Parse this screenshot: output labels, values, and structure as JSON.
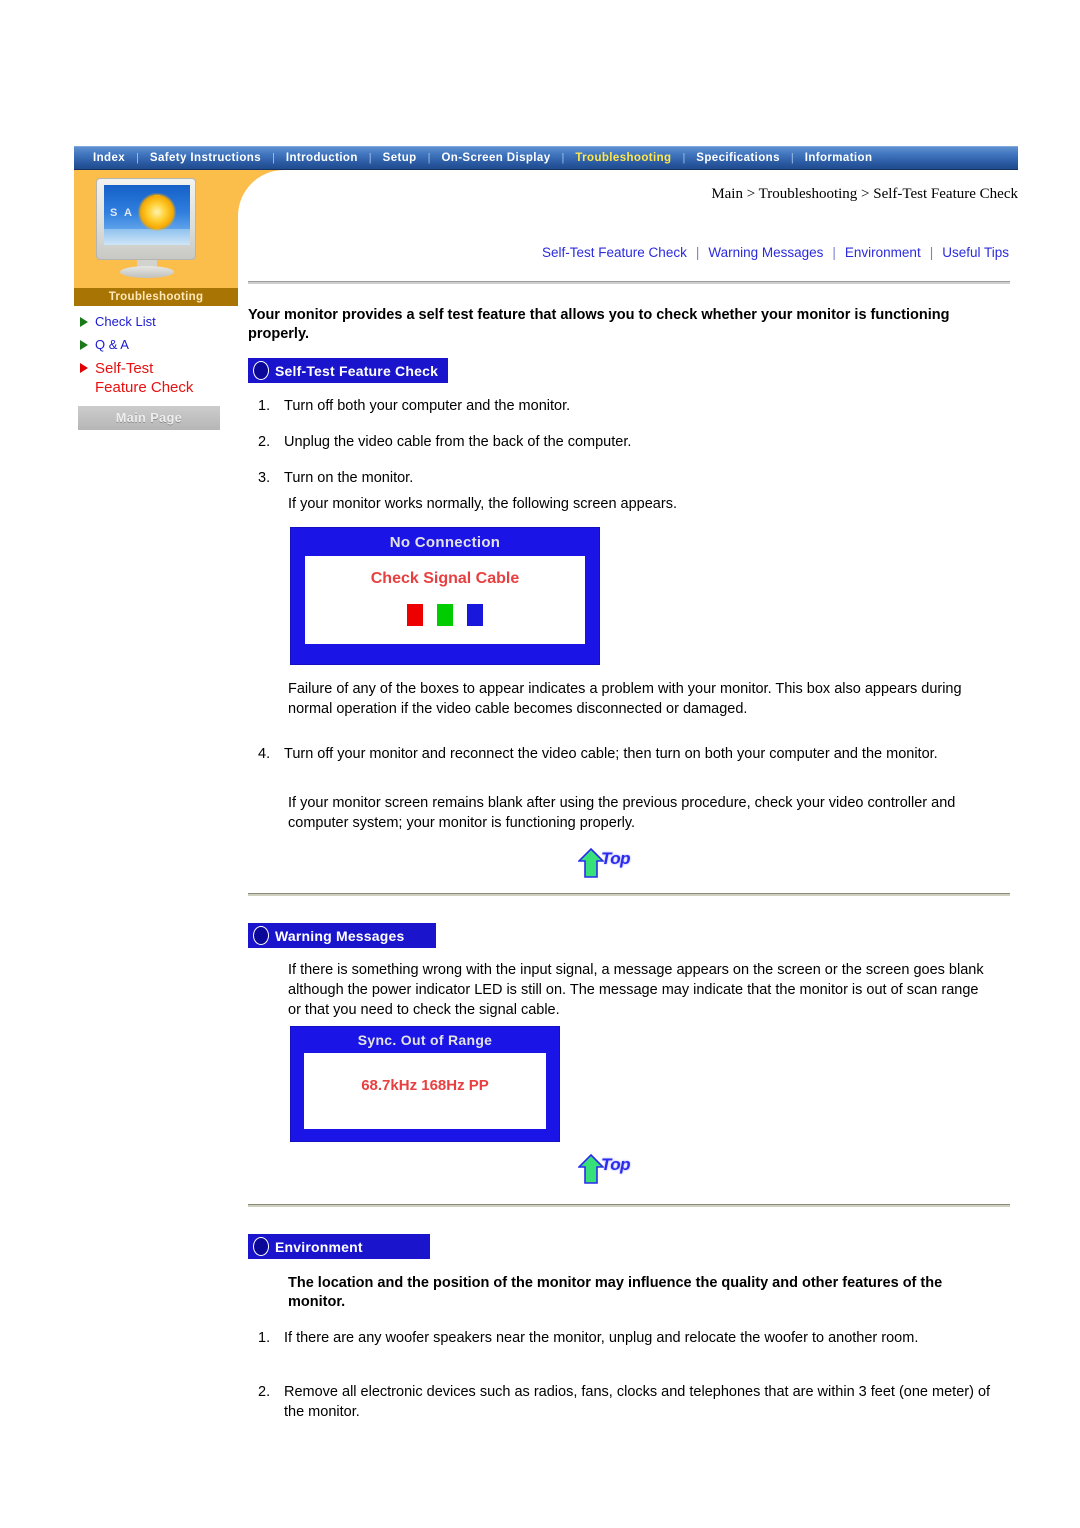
{
  "topnav": {
    "items": [
      {
        "label": "Index",
        "active": false
      },
      {
        "label": "Safety Instructions",
        "active": false
      },
      {
        "label": "Introduction",
        "active": false
      },
      {
        "label": "Setup",
        "active": false
      },
      {
        "label": "On-Screen Display",
        "active": false
      },
      {
        "label": "Troubleshooting",
        "active": true
      },
      {
        "label": "Specifications",
        "active": false
      },
      {
        "label": "Information",
        "active": false
      }
    ],
    "separator": "|",
    "active_color": "#ffe74c"
  },
  "sidebar": {
    "thumbnail_caption": "Troubleshooting",
    "thumbnail_screen_text": "S A",
    "links": [
      {
        "label": "Check List",
        "selected": false
      },
      {
        "label": "Q & A",
        "selected": false
      },
      {
        "label": "Self-Test",
        "label2": "Feature Check",
        "selected": true
      }
    ],
    "main_page_button": "Main Page",
    "panel_color": "#fbbe4b",
    "caption_bar_color": "#a87505",
    "link_color": "#1a1ad0",
    "selected_link_color": "#e81010"
  },
  "breadcrumb": "Main > Troubleshooting > Self-Test Feature Check",
  "sublinks": {
    "items": [
      "Self-Test Feature Check",
      "Warning Messages",
      "Environment",
      "Useful Tips"
    ],
    "separator": "|",
    "color": "#2b2bdd"
  },
  "lead": "Your monitor provides a self test feature that allows you to check whether your monitor is functioning properly.",
  "sections": {
    "self_test": {
      "banner": "Self-Test Feature Check",
      "steps": [
        {
          "num": "1.",
          "text": "Turn off both your computer and the monitor."
        },
        {
          "num": "2.",
          "text": "Unplug the video cable from the back of the computer."
        },
        {
          "num": "3.",
          "text": "Turn on the monitor."
        }
      ],
      "note_after_step3": "If your monitor works normally, the following screen appears.",
      "osd": {
        "title": "No Connection",
        "message": "Check Signal Cable",
        "swatches": [
          "#ee0000",
          "#00cc00",
          "#1818dd"
        ],
        "frame_color": "#1a15e6"
      },
      "paragraph_after_image": "Failure of any of the boxes to appear indicates a problem with your monitor. This box also appears during normal operation if the video cable becomes disconnected or damaged.",
      "step4": {
        "num": "4.",
        "text": "Turn off your monitor and reconnect the video cable; then turn on both your computer and the monitor."
      },
      "closing": "If your monitor screen remains blank after using the previous procedure, check your video controller and computer system; your monitor is functioning properly."
    },
    "warning_messages": {
      "banner": "Warning Messages",
      "paragraph": "If there is something wrong with the input signal, a message appears on the screen or the screen goes blank although the power indicator LED is still on. The message may indicate that the monitor is out of scan range or that you need to check the signal cable.",
      "osd": {
        "title": "Sync. Out of Range",
        "message": "68.7kHz  168Hz  PP",
        "frame_color": "#1a15e6"
      }
    },
    "environment": {
      "banner": "Environment",
      "heading": "The location and the position of the monitor may influence the quality and other features of the monitor.",
      "steps": [
        {
          "num": "1.",
          "text": "If there are any woofer speakers near the monitor, unplug and relocate the woofer to another room."
        },
        {
          "num": "2.",
          "text": "Remove all electronic devices such as radios, fans, clocks and telephones that are within 3 feet (one meter) of the monitor."
        }
      ]
    }
  },
  "top_buttons": {
    "label": "Top"
  }
}
